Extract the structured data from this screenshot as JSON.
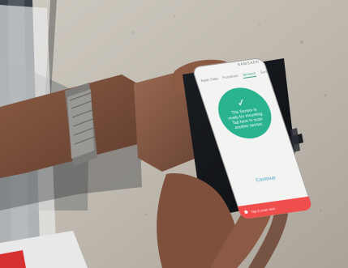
{
  "phone_ui": {
    "tabs": [
      "Basic Data",
      "Functions",
      "Sensors",
      "Summary"
    ],
    "active_tab_index": 2,
    "logo_text": "SAMSARA",
    "status_message": "The Sensor is ready for mounting. Tap here to scan another sensor.",
    "continue_label": "Continue",
    "footer_label": "Tap to scan next",
    "colors": {
      "accent_green": "#2bb38f",
      "link_blue": "#4aa3c8",
      "footer_red": "#f04d4d",
      "screen_bg": "#f3f3f1"
    }
  }
}
